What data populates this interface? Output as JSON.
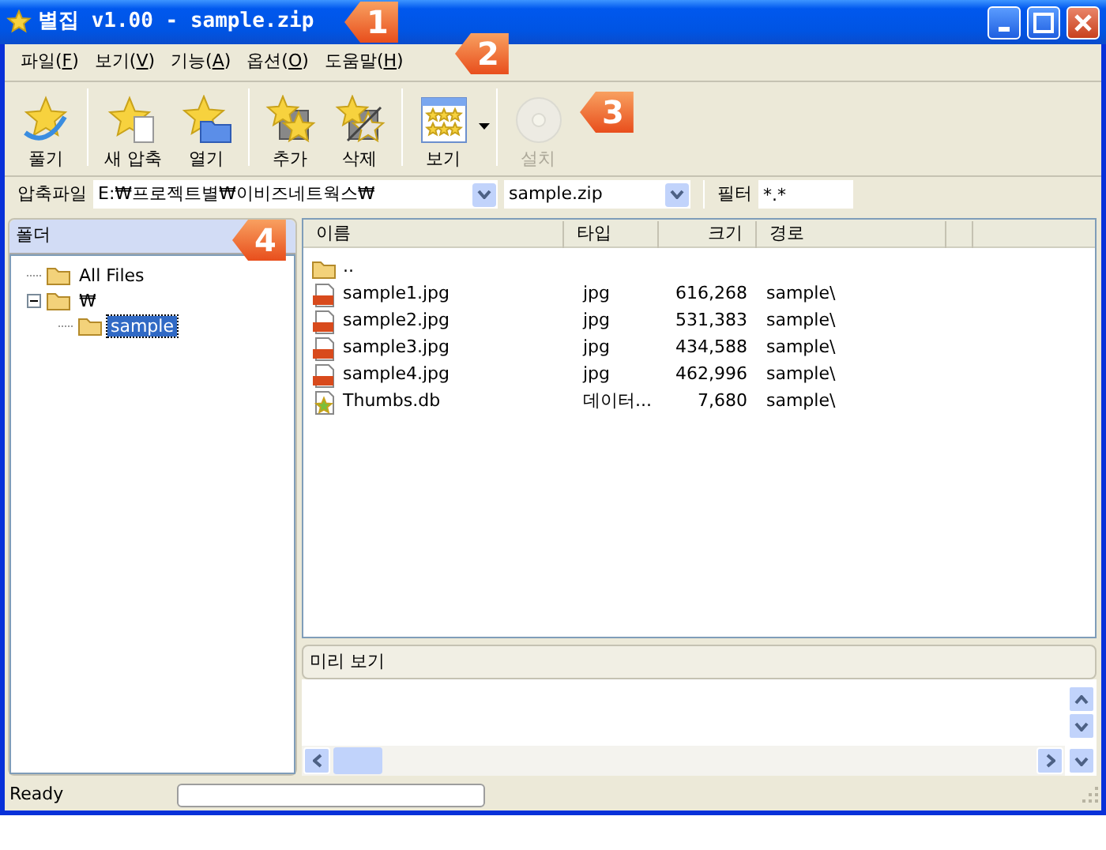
{
  "window": {
    "title": "별집 v1.00 - sample.zip"
  },
  "menu": [
    {
      "before": "파일(",
      "key": "F",
      "after": ")"
    },
    {
      "before": "보기(",
      "key": "V",
      "after": ")"
    },
    {
      "before": "기능(",
      "key": "A",
      "after": ")"
    },
    {
      "before": "옵션(",
      "key": "O",
      "after": ")"
    },
    {
      "before": "도움말(",
      "key": "H",
      "after": ")"
    }
  ],
  "toolbar": [
    {
      "kind": "extract",
      "label": "풀기",
      "disabled": false,
      "dropdown": false,
      "separator_after": true
    },
    {
      "kind": "new",
      "label": "새 압축",
      "disabled": false,
      "dropdown": false,
      "separator_after": false
    },
    {
      "kind": "open",
      "label": "열기",
      "disabled": false,
      "dropdown": false,
      "separator_after": true
    },
    {
      "kind": "add",
      "label": "추가",
      "disabled": false,
      "dropdown": false,
      "separator_after": false
    },
    {
      "kind": "delete",
      "label": "삭제",
      "disabled": false,
      "dropdown": false,
      "separator_after": true
    },
    {
      "kind": "view",
      "label": "보기",
      "disabled": false,
      "dropdown": true,
      "separator_after": true
    },
    {
      "kind": "install",
      "label": "설치",
      "disabled": true,
      "dropdown": false,
      "separator_after": false
    }
  ],
  "address": {
    "label": "압축파일",
    "path": "E:₩프로젝트별₩이비즈네트웍스₩",
    "file": "sample.zip",
    "filter_label": "필터",
    "filter": "*.*"
  },
  "folders": {
    "title": "폴더",
    "tree": [
      {
        "label": "All Files",
        "selected": false
      },
      {
        "label": "₩",
        "selected": false,
        "expanded": true,
        "children": [
          {
            "label": "sample",
            "selected": true
          }
        ]
      }
    ]
  },
  "files": {
    "columns": [
      "이름",
      "타입",
      "크기",
      "경로"
    ],
    "rows": [
      {
        "kind": "folder",
        "name": ".."
      },
      {
        "kind": "jpg",
        "name": "sample1.jpg",
        "type": "jpg",
        "size": "616,268",
        "path": "sample\\"
      },
      {
        "kind": "jpg",
        "name": "sample2.jpg",
        "type": "jpg",
        "size": "531,383",
        "path": "sample\\"
      },
      {
        "kind": "jpg",
        "name": "sample3.jpg",
        "type": "jpg",
        "size": "434,588",
        "path": "sample\\"
      },
      {
        "kind": "jpg",
        "name": "sample4.jpg",
        "type": "jpg",
        "size": "462,996",
        "path": "sample\\"
      },
      {
        "kind": "db",
        "name": "Thumbs.db",
        "type": "데이터...",
        "size": "7,680",
        "path": "sample\\"
      }
    ]
  },
  "preview": {
    "title": "미리 보기"
  },
  "status_bar": {
    "text": "Ready",
    "progress": {
      "level": 0
    }
  },
  "callouts": [
    {
      "number": "1"
    },
    {
      "number": "2"
    },
    {
      "number": "3"
    },
    {
      "number": "4"
    }
  ]
}
